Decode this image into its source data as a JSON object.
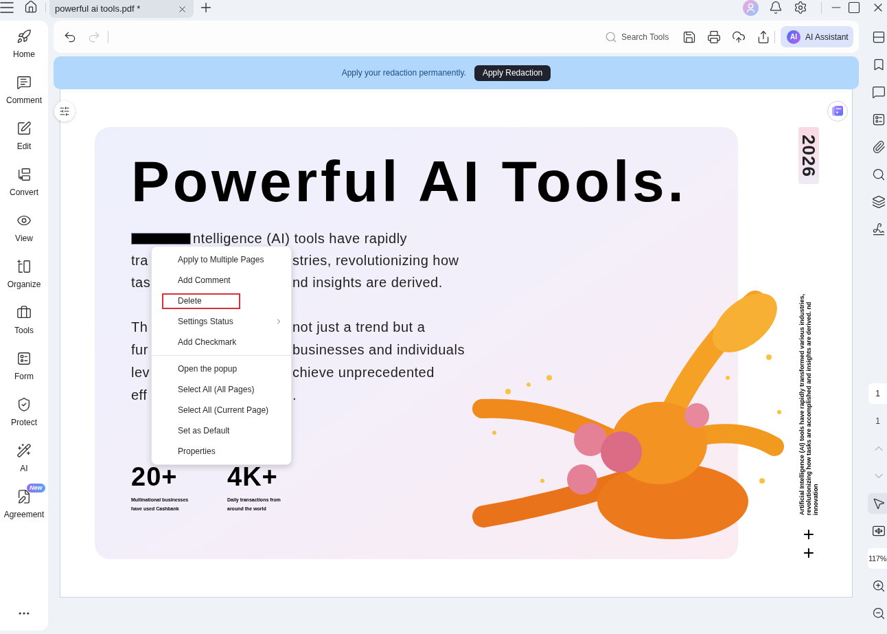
{
  "title_bar": {
    "tab": {
      "label": "powerful ai tools.pdf *",
      "selected": true
    }
  },
  "sidebar": {
    "items": [
      {
        "label": "Home"
      },
      {
        "label": "Comment"
      },
      {
        "label": "Edit"
      },
      {
        "label": "Convert"
      },
      {
        "label": "View"
      },
      {
        "label": "Organize"
      },
      {
        "label": "Tools"
      },
      {
        "label": "Form"
      },
      {
        "label": "Protect"
      },
      {
        "label": "AI"
      },
      {
        "label": "Agreement",
        "badge": "New"
      }
    ]
  },
  "toolbar": {
    "history": [
      {
        "disabled": false
      },
      {
        "disabled": true
      }
    ],
    "search": {
      "placeholder": "Search Tools"
    },
    "assistant": {
      "logo": "AI",
      "label": "AI Assistant"
    }
  },
  "banner": {
    "message": "Apply your redaction permanently.",
    "button": "Apply Redaction"
  },
  "document": {
    "title": "Powerful AI Tools.",
    "paragraph_1": {
      "redacted": true,
      "first_line": "ntelligence (AI) tools have rapidly",
      "lines": [
        {
          "left": "tra",
          "right": "stries, revolutionizing how"
        },
        {
          "left": "tas",
          "right": "nd insights are derived."
        }
      ]
    },
    "paragraph_2": {
      "lines": [
        {
          "left": "Th",
          "right": "not just a trend but a"
        },
        {
          "left": "fur",
          "right": "businesses and individuals"
        },
        {
          "left": "lev",
          "right": "chieve unprecedented"
        },
        {
          "left": "eff",
          "right": "."
        }
      ]
    },
    "stats": [
      {
        "value": "20+",
        "caption": "Multinational businesses have used Cashbank"
      },
      {
        "value": "4K+",
        "caption": "Daily transactions from around the world"
      }
    ],
    "year": "2026",
    "side_note": "Artificial Intelligence (AI) tools have rapidly transformed various industries, revolutionizing how tasks are accomplished and insights are derived. nd innovation",
    "marks": [
      "+",
      "+"
    ]
  },
  "context_menu": {
    "groups": [
      [
        {
          "label": "Apply to Multiple Pages",
          "submenu": false,
          "highlighted": false
        },
        {
          "label": "Add Comment",
          "submenu": false,
          "highlighted": false
        },
        {
          "label": "Delete",
          "submenu": false,
          "highlighted": true
        },
        {
          "label": "Settings Status",
          "submenu": true,
          "highlighted": false
        },
        {
          "label": "Add Checkmark",
          "submenu": false,
          "highlighted": false
        }
      ],
      [
        {
          "label": "Open the popup",
          "submenu": false,
          "highlighted": false
        },
        {
          "label": "Select All (All Pages)",
          "submenu": false,
          "highlighted": false
        },
        {
          "label": "Select All (Current Page)",
          "submenu": false,
          "highlighted": false
        },
        {
          "label": "Set as Default",
          "submenu": false,
          "highlighted": false
        },
        {
          "label": "Properties",
          "submenu": false,
          "highlighted": false
        }
      ]
    ]
  },
  "right_panel": {
    "page_input": "1",
    "page_count": "1",
    "page_nav": [
      {
        "disabled": true
      },
      {
        "disabled": true
      }
    ],
    "tools": [
      {
        "selected": true
      },
      {
        "selected": false
      }
    ],
    "zoom": "117%"
  }
}
